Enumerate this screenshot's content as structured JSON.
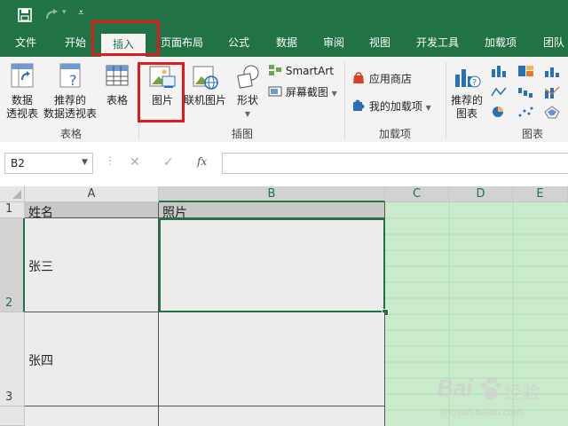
{
  "menu": {
    "tabs": [
      "文件",
      "开始",
      "插入",
      "页面布局",
      "公式",
      "数据",
      "审阅",
      "视图",
      "开发工具",
      "加载项",
      "团队"
    ]
  },
  "ribbon": {
    "table_group": {
      "name": "表格",
      "pivot": [
        "数据",
        "透视表"
      ],
      "recommended_pivot": [
        "推荐的",
        "数据透视表"
      ],
      "table": "表格"
    },
    "illus_group": {
      "name": "插图",
      "picture": "图片",
      "online_picture": "联机图片",
      "shapes": "形状",
      "smartart": "SmartArt",
      "screenshot": "屏幕截图"
    },
    "addins_group": {
      "name": "加载项",
      "store": "应用商店",
      "my_addins": "我的加载项"
    },
    "charts_group": {
      "name": "图表",
      "recommended": [
        "推荐的",
        "图表"
      ]
    }
  },
  "formula_bar": {
    "name_box": "B2",
    "fx": "fx",
    "value": ""
  },
  "sheet": {
    "columns": [
      "A",
      "B",
      "C",
      "D",
      "E"
    ],
    "rows": [
      "1",
      "2",
      "3"
    ],
    "cells": {
      "A1": "姓名",
      "B1": "照片",
      "A2": "张三",
      "A3": "张四"
    }
  },
  "watermark": {
    "brand": "Bai",
    "brand2": "经验",
    "url": "jingyan.baidu.com"
  },
  "colors": {
    "accent": "#217346",
    "highlight": "#e0191f",
    "selection": "#c9ebcb"
  }
}
